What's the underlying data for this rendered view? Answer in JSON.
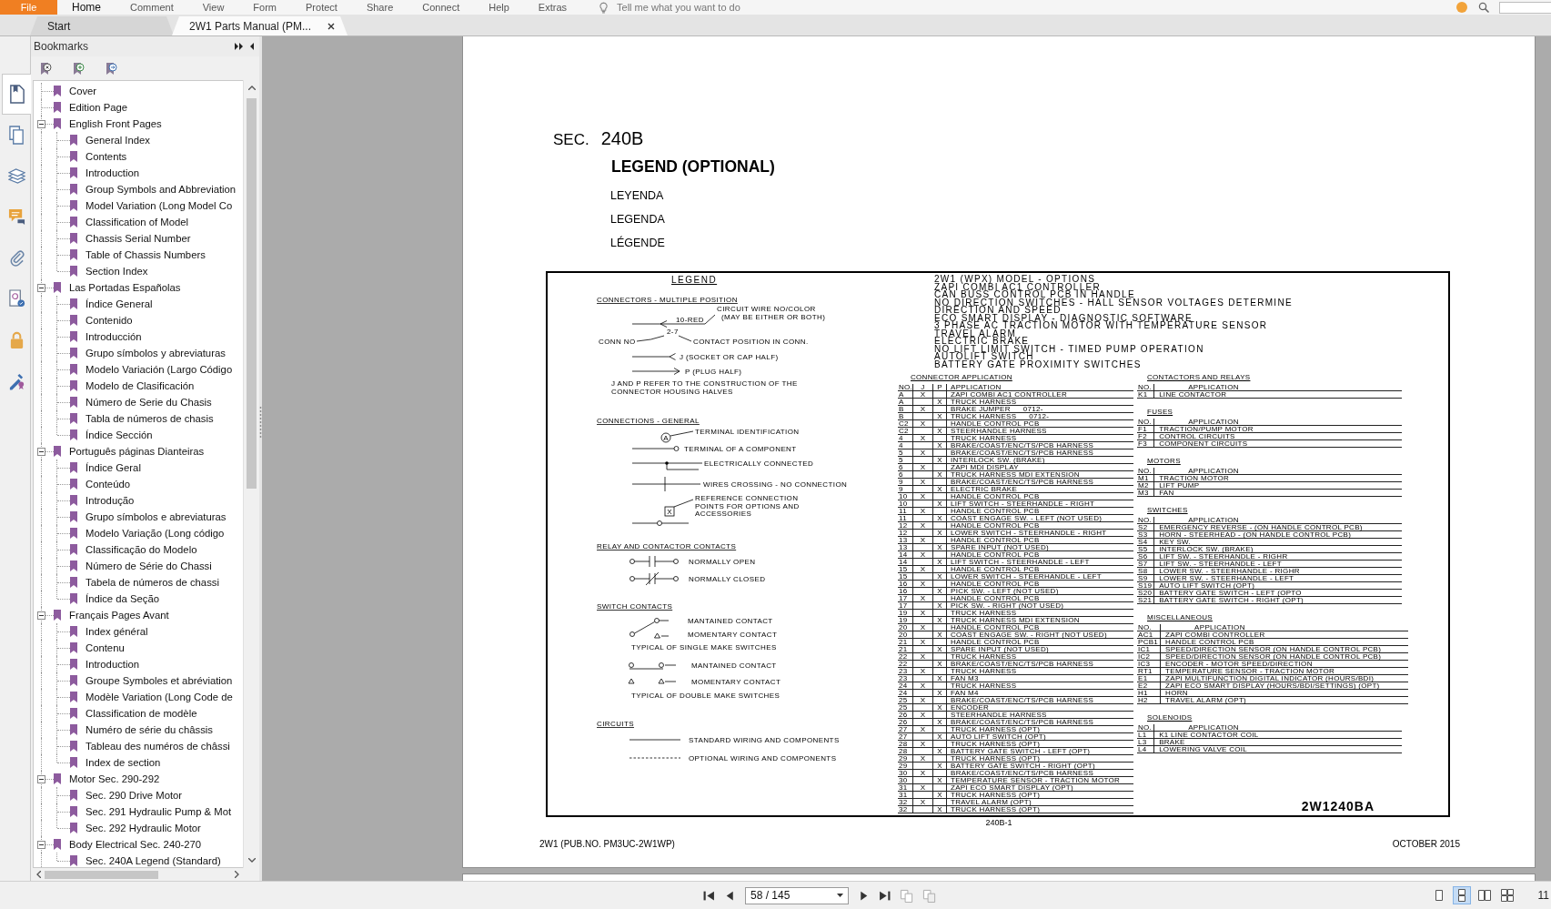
{
  "menu_bar": {
    "items": [
      {
        "label": "File",
        "kind": "file",
        "selected": false
      },
      {
        "label": "Home",
        "kind": "tab",
        "selected": true
      },
      {
        "label": "Comment",
        "kind": "tab",
        "selected": false
      },
      {
        "label": "View",
        "kind": "tab",
        "selected": false
      },
      {
        "label": "Form",
        "kind": "tab",
        "selected": false
      },
      {
        "label": "Protect",
        "kind": "tab",
        "selected": false
      },
      {
        "label": "Share",
        "kind": "tab",
        "selected": false
      },
      {
        "label": "Connect",
        "kind": "tab",
        "selected": false
      },
      {
        "label": "Help",
        "kind": "tab",
        "selected": false
      },
      {
        "label": "Extras",
        "kind": "tab",
        "selected": false
      }
    ],
    "tell_me": {
      "placeholder": "Tell me what you want to do"
    }
  },
  "tabs": [
    {
      "label": "Start",
      "selected": false,
      "closable": false
    },
    {
      "label": "2W1 Parts Manual (PM...",
      "selected": true,
      "closable": true
    }
  ],
  "panel_icons": [
    {
      "kind": "bookmarks",
      "selected": true
    },
    {
      "kind": "pages",
      "selected": false
    },
    {
      "kind": "layers",
      "selected": false
    },
    {
      "kind": "comments",
      "selected": false
    },
    {
      "kind": "attachments",
      "selected": false
    },
    {
      "kind": "signatures",
      "selected": false
    },
    {
      "kind": "security",
      "selected": false
    },
    {
      "kind": "sign",
      "selected": false
    }
  ],
  "sidebar": {
    "title": "Bookmarks",
    "bookmarks": [
      {
        "label": "Cover"
      },
      {
        "label": "Edition Page"
      },
      {
        "label": "English Front Pages",
        "expanded": true,
        "children": [
          {
            "label": "General Index"
          },
          {
            "label": "Contents"
          },
          {
            "label": "Introduction"
          },
          {
            "label": "Group Symbols and Abbreviation"
          },
          {
            "label": "Model Variation (Long Model Co"
          },
          {
            "label": "Classification of Model"
          },
          {
            "label": "Chassis Serial Number"
          },
          {
            "label": "Table of Chassis Numbers"
          },
          {
            "label": "Section Index"
          }
        ]
      },
      {
        "label": "Las Portadas Españolas",
        "expanded": true,
        "children": [
          {
            "label": "Índice General"
          },
          {
            "label": "Contenido"
          },
          {
            "label": "Introducción"
          },
          {
            "label": "Grupo símbolos y abreviaturas"
          },
          {
            "label": "Modelo Variación (Largo Código"
          },
          {
            "label": "Modelo de Clasificación"
          },
          {
            "label": "Número de Serie du Chasis"
          },
          {
            "label": "Tabla de números de chasis"
          },
          {
            "label": "Índice Sección"
          }
        ]
      },
      {
        "label": "Português páginas Dianteiras",
        "expanded": true,
        "children": [
          {
            "label": "Índice Geral"
          },
          {
            "label": "Conteúdo"
          },
          {
            "label": "Introdução"
          },
          {
            "label": "Grupo símbolos e abreviaturas"
          },
          {
            "label": "Modelo Variação (Long código"
          },
          {
            "label": "Classificação do Modelo"
          },
          {
            "label": "Número de Série do Chassi"
          },
          {
            "label": "Tabela de números de chassi"
          },
          {
            "label": "Índice da Seção"
          }
        ]
      },
      {
        "label": "Français Pages Avant",
        "expanded": true,
        "children": [
          {
            "label": "Index général"
          },
          {
            "label": "Contenu"
          },
          {
            "label": "Introduction"
          },
          {
            "label": "Groupe Symboles et abréviation"
          },
          {
            "label": "Modèle Variation (Long Code de"
          },
          {
            "label": "Classification de modèle"
          },
          {
            "label": "Numéro de série du châssis"
          },
          {
            "label": "Tableau des numéros de châssi"
          },
          {
            "label": "Index de section"
          }
        ]
      },
      {
        "label": "Motor Sec. 290-292",
        "expanded": true,
        "children": [
          {
            "label": "Sec. 290 Drive Motor"
          },
          {
            "label": "Sec. 291 Hydraulic Pump & Mot"
          },
          {
            "label": "Sec. 292 Hydraulic Motor"
          }
        ]
      },
      {
        "label": "Body Electrical Sec. 240-270",
        "expanded": true,
        "children": [
          {
            "label": "Sec. 240A Legend (Standard)"
          }
        ]
      }
    ]
  },
  "document": {
    "page": {
      "section_label": "SEC.",
      "section_number": "240B",
      "title": "LEGEND (OPTIONAL)",
      "translations": [
        "LEYENDA",
        "LEGENDA",
        "LÉGENDE"
      ],
      "figure": {
        "legend": {
          "title": "LEGEND",
          "connectors": {
            "heading": "CONNECTORS - MULTIPLE POSITION",
            "wire": "10-RED",
            "wire_note": [
              "CIRCUIT WIRE NO/COLOR",
              "(MAY BE EITHER OR BOTH)"
            ],
            "position": "2-7",
            "conn_no": "CONN NO",
            "contact_position": "CONTACT POSITION IN CONN.",
            "socket": "J (SOCKET OR CAP HALF)",
            "plug": "P (PLUG HALF)",
            "note": [
              "J AND P REFER TO THE CONSTRUCTION OF THE",
              "CONNECTOR HOUSING HALVES"
            ]
          },
          "connections": {
            "heading": "CONNECTIONS - GENERAL",
            "terminal_id": "TERMINAL IDENTIFICATION",
            "terminal_letter": "A",
            "terminal": "TERMINAL OF A COMPONENT",
            "connected": "ELECTRICALLY CONNECTED",
            "crossing": "WIRES CROSSING - NO CONNECTION",
            "reference": [
              "REFERENCE CONNECTION",
              "POINTS FOR OPTIONS AND",
              "ACCESSORIES"
            ],
            "reference_mark": "X"
          },
          "relays": {
            "heading": "RELAY AND CONTACTOR CONTACTS",
            "open": "NORMALLY OPEN",
            "closed": "NORMALLY CLOSED"
          },
          "switches": {
            "heading": "SWITCH CONTACTS",
            "single": [
              "MANTAINED CONTACT",
              "MOMENTARY CONTACT"
            ],
            "single_note": "TYPICAL OF SINGLE MAKE SWITCHES",
            "double": [
              "MANTAINED CONTACT",
              "MOMENTARY CONTACT"
            ],
            "double_note": "TYPICAL OF DOUBLE MAKE SWITCHES"
          },
          "circuits": {
            "heading": "CIRCUITS",
            "standard": "STANDARD WIRING AND COMPONENTS",
            "optional": "OPTIONAL WIRING AND COMPONENTS"
          }
        },
        "options": [
          "2W1 (WPX) MODEL - OPTIONS",
          "ZAPI COMBI AC1 CONTROLLER",
          "CAN BUSS CONTROL PCB IN HANDLE",
          "NO DIRECTION SWITCHES - HALL SENSOR VOLTAGES DETERMINE",
          "DIRECTION AND SPEED",
          "ECO SMART DISPLAY - DIAGNOSTIC SOFTWARE",
          "3 PHASE AC TRACTION MOTOR WITH TEMPERATURE SENSOR",
          "TRAVEL ALARM",
          "ELECTRIC BRAKE",
          "NO LIFT LIMIT SWITCH - TIMED PUMP OPERATION",
          "AUTOLIFT SWITCH",
          "BATTERY GATE PROXIMITY SWITCHES"
        ],
        "connector_application": {
          "title": "CONNECTOR APPLICATION",
          "columns": [
            "NO.",
            "J",
            "P",
            "APPLICATION"
          ],
          "rows": [
            {
              "no": "A",
              "j": "X",
              "application": "ZAPI COMBI AC1 CONTROLLER"
            },
            {
              "no": "A",
              "p": "X",
              "application": "TRUCK HARNESS"
            },
            {
              "no": "B",
              "j": "X",
              "application": "BRAKE JUMPER",
              "note": "0712-"
            },
            {
              "no": "B",
              "p": "X",
              "application": "TRUCK HARNESS",
              "note": "0712-"
            },
            {
              "no": "C2",
              "j": "X",
              "application": "HANDLE CONTROL PCB"
            },
            {
              "no": "C2",
              "p": "X",
              "application": "STEERHANDLE HARNESS"
            },
            {
              "no": "4",
              "j": "X",
              "application": "TRUCK HARNESS"
            },
            {
              "no": "4",
              "p": "X",
              "application": "BRAKE/COAST/ENC/TS/PCB HARNESS"
            },
            {
              "no": "5",
              "j": "X",
              "application": "BRAKE/COAST/ENC/TS/PCB HARNESS"
            },
            {
              "no": "5",
              "p": "X",
              "application": "INTERLOCK SW. (BRAKE)"
            },
            {
              "no": "6",
              "j": "X",
              "application": "ZAPI MDI DISPLAY"
            },
            {
              "no": "6",
              "p": "X",
              "application": "TRUCK HARNESS MDI EXTENSION"
            },
            {
              "no": "9",
              "j": "X",
              "application": "BRAKE/COAST/ENC/TS/PCB HARNESS"
            },
            {
              "no": "9",
              "p": "X",
              "application": "ELECTRIC BRAKE"
            },
            {
              "no": "10",
              "j": "X",
              "application": "HANDLE CONTROL PCB"
            },
            {
              "no": "10",
              "p": "X",
              "application": "LIFT SWITCH - STEERHANDLE - RIGHT"
            },
            {
              "no": "11",
              "j": "X",
              "application": "HANDLE CONTROL PCB"
            },
            {
              "no": "11",
              "p": "X",
              "application": "COAST ENGAGE SW. - LEFT (NOT USED)"
            },
            {
              "no": "12",
              "j": "X",
              "application": "HANDLE CONTROL PCB"
            },
            {
              "no": "12",
              "p": "X",
              "application": "LOWER SWITCH - STEERHANDLE - RIGHT"
            },
            {
              "no": "13",
              "j": "X",
              "application": "HANDLE CONTROL PCB"
            },
            {
              "no": "13",
              "p": "X",
              "application": "SPARE INPUT (NOT USED)"
            },
            {
              "no": "14",
              "j": "X",
              "application": "HANDLE CONTROL PCB"
            },
            {
              "no": "14",
              "p": "X",
              "application": "LIFT SWITCH - STEERHANDLE - LEFT"
            },
            {
              "no": "15",
              "j": "X",
              "application": "HANDLE CONTROL PCB"
            },
            {
              "no": "15",
              "p": "X",
              "application": "LOWER SWITCH - STEERHANDLE - LEFT"
            },
            {
              "no": "16",
              "j": "X",
              "application": "HANDLE CONTROL PCB"
            },
            {
              "no": "16",
              "p": "X",
              "application": "PICK SW. - LEFT (NOT USED)"
            },
            {
              "no": "17",
              "j": "X",
              "application": "HANDLE CONTROL PCB"
            },
            {
              "no": "17",
              "p": "X",
              "application": "PICK SW. - RIGHT (NOT USED)"
            },
            {
              "no": "19",
              "j": "X",
              "application": "TRUCK HARNESS"
            },
            {
              "no": "19",
              "p": "X",
              "application": "TRUCK HARNESS MDI EXTENSION"
            },
            {
              "no": "20",
              "j": "X",
              "application": "HANDLE CONTROL PCB"
            },
            {
              "no": "20",
              "p": "X",
              "application": "COAST ENGAGE SW. - RIGHT (NOT USED)"
            },
            {
              "no": "21",
              "j": "X",
              "application": "HANDLE CONTROL PCB"
            },
            {
              "no": "21",
              "p": "X",
              "application": "SPARE INPUT (NOT USED)"
            },
            {
              "no": "22",
              "j": "X",
              "application": "TRUCK HARNESS"
            },
            {
              "no": "22",
              "p": "X",
              "application": "BRAKE/COAST/ENC/TS/PCB HARNESS"
            },
            {
              "no": "23",
              "j": "X",
              "application": "TRUCK HARNESS"
            },
            {
              "no": "23",
              "p": "X",
              "application": "FAN M3"
            },
            {
              "no": "24",
              "j": "X",
              "application": "TRUCK HARNESS"
            },
            {
              "no": "24",
              "p": "X",
              "application": "FAN M4"
            },
            {
              "no": "25",
              "j": "X",
              "application": "BRAKE/COAST/ENC/TS/PCB HARNESS"
            },
            {
              "no": "25",
              "p": "X",
              "application": "ENCODER"
            },
            {
              "no": "26",
              "j": "X",
              "application": "STEERHANDLE HARNESS"
            },
            {
              "no": "26",
              "p": "X",
              "application": "BRAKE/COAST/ENC/TS/PCB HARNESS"
            },
            {
              "no": "27",
              "j": "X",
              "application": "TRUCK HARNESS (OPT)"
            },
            {
              "no": "27",
              "p": "X",
              "application": "AUTO LIFT SWITCH (OPT)"
            },
            {
              "no": "28",
              "j": "X",
              "application": "TRUCK HARNESS (OPT)"
            },
            {
              "no": "28",
              "p": "X",
              "application": "BATTERY GATE SWITCH - LEFT (OPT)"
            },
            {
              "no": "29",
              "j": "X",
              "application": "TRUCK HARNESS (OPT)"
            },
            {
              "no": "29",
              "p": "X",
              "application": "BATTERY GATE SWITCH - RIGHT (OPT)"
            },
            {
              "no": "30",
              "j": "X",
              "application": "BRAKE/COAST/ENC/TS/PCB HARNESS"
            },
            {
              "no": "30",
              "p": "X",
              "application": "TEMPERATURE SENSOR - TRACTION MOTOR"
            },
            {
              "no": "31",
              "j": "X",
              "application": "ZAPI ECO SMART DISPLAY (OPT)"
            },
            {
              "no": "31",
              "p": "X",
              "application": "TRUCK HARNESS (OPT)"
            },
            {
              "no": "32",
              "j": "X",
              "application": "TRAVEL ALARM (OPT)"
            },
            {
              "no": "32",
              "p": "X",
              "application": "TRUCK HARNESS (OPT)"
            }
          ]
        },
        "component_tables": [
          {
            "title": "CONTACTORS AND RELAYS",
            "columns": [
              "NO.",
              "APPLICATION"
            ],
            "rows": [
              {
                "no": "K1",
                "application": "LINE CONTACTOR"
              }
            ]
          },
          {
            "title": "FUSES",
            "columns": [
              "NO.",
              "APPLICATION"
            ],
            "rows": [
              {
                "no": "F1",
                "application": "TRACTION/PUMP MOTOR"
              },
              {
                "no": "F2",
                "application": "CONTROL CIRCUITS"
              },
              {
                "no": "F3",
                "application": "COMPONENT CIRCUITS"
              }
            ]
          },
          {
            "title": "MOTORS",
            "columns": [
              "NO.",
              "APPLICATION"
            ],
            "rows": [
              {
                "no": "M1",
                "application": "TRACTION MOTOR"
              },
              {
                "no": "M2",
                "application": "LIFT PUMP"
              },
              {
                "no": "M3",
                "application": "FAN"
              }
            ]
          },
          {
            "title": "SWITCHES",
            "columns": [
              "NO.",
              "APPLICATION"
            ],
            "rows": [
              {
                "no": "S2",
                "application": "EMERGENCY REVERSE - (ON HANDLE CONTROL PCB)"
              },
              {
                "no": "S3",
                "application": "HORN - STEERHEAD - (ON HANDLE CONTROL PCB)"
              },
              {
                "no": "S4",
                "application": "KEY SW."
              },
              {
                "no": "S5",
                "application": "INTERLOCK SW. (BRAKE)"
              },
              {
                "no": "S6",
                "application": "LIFT SW. - STEERHANDLE - RIGHR"
              },
              {
                "no": "S7",
                "application": "LIFT SW. - STEERHANDLE - LEFT"
              },
              {
                "no": "S8",
                "application": "LOWER SW. - STEERHANDLE - RIGHR"
              },
              {
                "no": "S9",
                "application": "LOWER SW. - STEERHANDLE - LEFT"
              },
              {
                "no": "S19",
                "application": "AUTO LIFT SWITCH (OPT)"
              },
              {
                "no": "S20",
                "application": "BATTERY GATE SWITCH - LEFT (OPTO"
              },
              {
                "no": "S21",
                "application": "BATTERY GATE SWITCH - RIGHT (OPT)"
              }
            ]
          },
          {
            "title": "MISCELLANEOUS",
            "columns": [
              "NO.",
              "APPLICATION"
            ],
            "rows": [
              {
                "no": "AC1",
                "application": "ZAPI COMBI CONTROLLER"
              },
              {
                "no": "PCB1",
                "application": "HANDLE CONTROL PCB"
              },
              {
                "no": "IC1",
                "application": "SPEED/DIRECTION SENSOR (ON HANDLE CONTROL PCB)"
              },
              {
                "no": "IC2",
                "application": "SPEED/DIRECTION SENSOR (ON HANDLE CONTROL PCB)"
              },
              {
                "no": "IC3",
                "application": "ENCODER - MOTOR SPEED/DIRECTION"
              },
              {
                "no": "RT1",
                "application": "TEMPERATURE SENSOR - TRACTION MOTOR"
              },
              {
                "no": "E1",
                "application": "ZAPI MULTIFUNCTION DIGITAL INDICATOR (HOURS/BDI)"
              },
              {
                "no": "E2",
                "application": "ZAPI ECO SMART DISPLAY (HOURS/BDI/SETTINGS) (OPT)"
              },
              {
                "no": "H1",
                "application": "HORN"
              },
              {
                "no": "H2",
                "application": "TRAVEL ALARM (OPT)"
              }
            ]
          },
          {
            "title": "SOLENOIDS",
            "columns": [
              "NO.",
              "APPLICATION"
            ],
            "rows": [
              {
                "no": "L1",
                "application": "K1 LINE CONTACTOR COIL"
              },
              {
                "no": "L3",
                "application": "BRAKE"
              },
              {
                "no": "L4",
                "application": "LOWERING VALVE COIL"
              }
            ]
          }
        ],
        "drawing_number": "2W1240BA"
      },
      "figure_number": "240B-1",
      "footer_left": "2W1 (PUB.NO. PM3UC-2W1WP)",
      "footer_right": "OCTOBER 2015"
    }
  },
  "status_bar": {
    "page_field": "58 / 145",
    "view_modes": [
      {
        "kind": "single",
        "selected": false
      },
      {
        "kind": "continuous",
        "selected": true
      },
      {
        "kind": "facing",
        "selected": false
      },
      {
        "kind": "continuous_facing",
        "selected": false
      }
    ],
    "zoom_value": "11"
  }
}
